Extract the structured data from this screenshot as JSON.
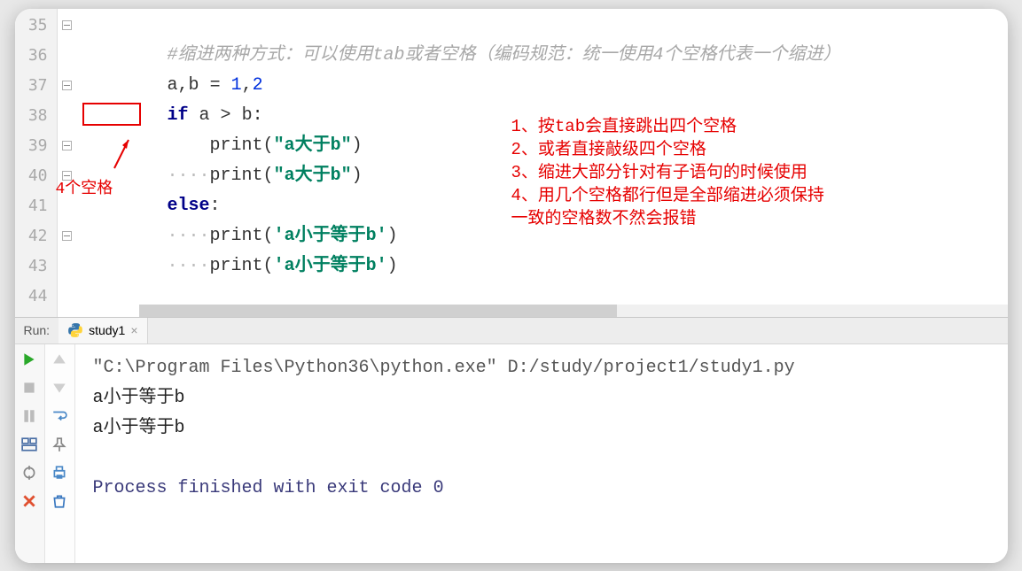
{
  "editor": {
    "line_numbers": [
      "35",
      "36",
      "37",
      "38",
      "39",
      "40",
      "41",
      "42",
      "43",
      "44"
    ],
    "lines": {
      "l35": {
        "comment_pre": "#缩进两种方式：可以使用",
        "comment_tab": "tab",
        "comment_mid": "或者空格（编码规范：统一使用",
        "comment_num": "4",
        "comment_end": "个空格代表一个缩进）"
      },
      "l36": {
        "a": "a",
        "comma": ",",
        "b": "b",
        "eq": " = ",
        "one": "1",
        "c2": ",",
        "two": "2"
      },
      "l37": {
        "if": "if ",
        "a": "a",
        "gt": " > ",
        "b": "b",
        "colon": ":"
      },
      "l38": {
        "indent": "    ",
        "print": "print",
        "paren_open": "(",
        "str": "\"a大于b\"",
        "paren_close": ")"
      },
      "l39": {
        "indent": "····",
        "print": "print",
        "paren_open": "(",
        "str": "\"a大于b\"",
        "paren_close": ")"
      },
      "l40": {
        "else": "else",
        "colon": ":"
      },
      "l41": {
        "indent": "····",
        "print": "print",
        "paren_open": "(",
        "str": "'a小于等于b'",
        "paren_close": ")"
      },
      "l42": {
        "indent": "····",
        "print": "print",
        "paren_open": "(",
        "str": "'a小于等于b'",
        "paren_close": ")"
      }
    },
    "annotations": {
      "label_4spaces": "4个空格",
      "notes": [
        "1、按tab会直接跳出四个空格",
        "2、或者直接敲级四个空格",
        "3、缩进大部分针对有子语句的时候使用",
        "4、用几个空格都行但是全部缩进必须保持",
        "一致的空格数不然会报错"
      ]
    }
  },
  "run": {
    "label": "Run:",
    "tab_name": "study1",
    "console": {
      "command": "\"C:\\Program Files\\Python36\\python.exe\" D:/study/project1/study1.py",
      "output1": "a小于等于b",
      "output2": "a小于等于b",
      "finished": "Process finished with exit code 0"
    }
  },
  "icons": {
    "python": "python-icon",
    "close": "×"
  }
}
